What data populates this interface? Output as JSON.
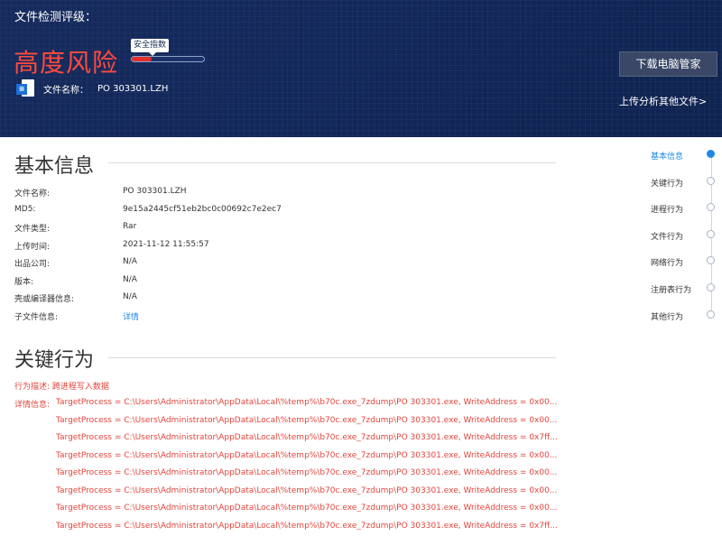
{
  "header": {
    "title": "文件检测评级：",
    "risk_level": "高度风险",
    "safety_tag": "安全指数",
    "safety_level": 0.27,
    "file_label": "文件名称：",
    "file_name": "PO 303301.LZH",
    "download_button": "下载电脑管家",
    "upload_link": "上传分析其他文件>",
    "accent_color": "#ff4a3d"
  },
  "basic": {
    "title": "基本信息",
    "rows": [
      {
        "label": "文件名称:",
        "value": "PO 303301.LZH"
      },
      {
        "label": "MD5:",
        "value": "9e15a2445cf51eb2bc0c00692c7e2ec7"
      },
      {
        "label": "文件类型:",
        "value": "Rar"
      },
      {
        "label": "上传时间:",
        "value": "2021-11-12 11:55:57"
      },
      {
        "label": "出品公司:",
        "value": "N/A"
      },
      {
        "label": "版本:",
        "value": "N/A"
      },
      {
        "label": "壳或编译器信息:",
        "value": "N/A"
      },
      {
        "label": "子文件信息:",
        "value": "详情"
      }
    ]
  },
  "key": {
    "title": "关键行为",
    "desc_label": "行为描述:",
    "desc_value": "跨进程写入数据",
    "detail_label": "详情信息:",
    "details": [
      "TargetProcess = C:\\Users\\Administrator\\AppData\\Local\\%temp%\\b70c.exe_7zdump\\PO 303301.exe, WriteAddress = 0x00...",
      "TargetProcess = C:\\Users\\Administrator\\AppData\\Local\\%temp%\\b70c.exe_7zdump\\PO 303301.exe, WriteAddress = 0x00...",
      "TargetProcess = C:\\Users\\Administrator\\AppData\\Local\\%temp%\\b70c.exe_7zdump\\PO 303301.exe, WriteAddress = 0x7ff...",
      "TargetProcess = C:\\Users\\Administrator\\AppData\\Local\\%temp%\\b70c.exe_7zdump\\PO 303301.exe, WriteAddress = 0x00...",
      "TargetProcess = C:\\Users\\Administrator\\AppData\\Local\\%temp%\\b70c.exe_7zdump\\PO 303301.exe, WriteAddress = 0x00...",
      "TargetProcess = C:\\Users\\Administrator\\AppData\\Local\\%temp%\\b70c.exe_7zdump\\PO 303301.exe, WriteAddress = 0x00...",
      "TargetProcess = C:\\Users\\Administrator\\AppData\\Local\\%temp%\\b70c.exe_7zdump\\PO 303301.exe, WriteAddress = 0x00...",
      "TargetProcess = C:\\Users\\Administrator\\AppData\\Local\\%temp%\\b70c.exe_7zdump\\PO 303301.exe, WriteAddress = 0x7ff..."
    ]
  },
  "nav": {
    "items": [
      "基本信息",
      "关键行为",
      "进程行为",
      "文件行为",
      "网络行为",
      "注册表行为",
      "其他行为"
    ],
    "active_index": 0
  }
}
